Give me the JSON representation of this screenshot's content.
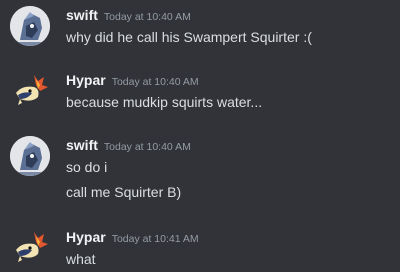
{
  "messages": [
    {
      "author": "swift",
      "timestamp": "Today at 10:40 AM",
      "avatar_icon": "swift-avatar-icon",
      "lines": [
        "why did he call his Swampert Squirter :("
      ]
    },
    {
      "author": "Hypar",
      "timestamp": "Today at 10:40 AM",
      "avatar_icon": "hypar-avatar-icon",
      "lines": [
        "because mudkip squirts water..."
      ]
    },
    {
      "author": "swift",
      "timestamp": "Today at 10:40 AM",
      "avatar_icon": "swift-avatar-icon",
      "lines": [
        "so do i",
        "call me Squirter B)"
      ]
    },
    {
      "author": "Hypar",
      "timestamp": "Today at 10:41 AM",
      "avatar_icon": "hypar-avatar-icon",
      "lines": [
        "what"
      ]
    }
  ],
  "colors": {
    "background": "#313338",
    "author_text": "#f2f3f5",
    "timestamp_text": "#949ba4",
    "message_text": "#dbdee1"
  }
}
